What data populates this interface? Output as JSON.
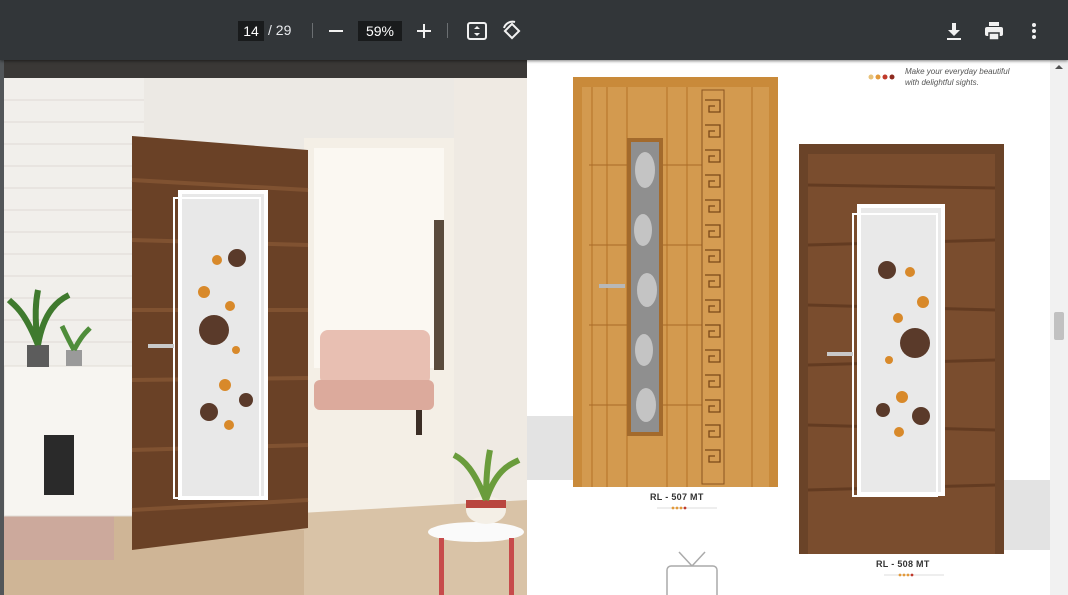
{
  "toolbar": {
    "page_current": "14",
    "page_total": "/ 29",
    "zoom": "59%",
    "icons": [
      "minus-icon",
      "plus-icon",
      "fit-page-icon",
      "rotate-icon",
      "download-icon",
      "print-icon",
      "more-vert-icon"
    ]
  },
  "page": {
    "tagline_line1": "Make your everyday beautiful",
    "tagline_line2": "with delightful sights.",
    "door1_label": "RL - 507 MT",
    "door2_label": "RL - 508 MT",
    "dot_colors": [
      "#e8c27a",
      "#e39a3b",
      "#c0392b",
      "#8e2a1f"
    ]
  },
  "scrollbar": {
    "position": 0.48
  }
}
